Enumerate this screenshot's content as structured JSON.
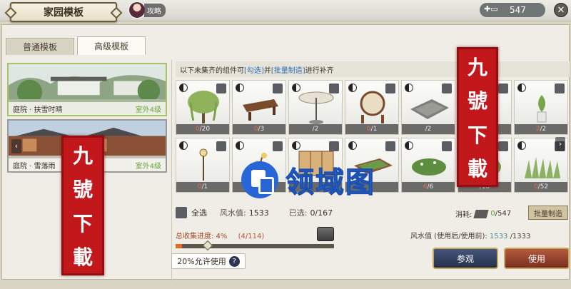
{
  "header": {
    "title": "家园模板",
    "guide_label": "攻略",
    "currency_value": "547",
    "close_glyph": "✕"
  },
  "tabs": [
    {
      "label": "普通模板",
      "active": false
    },
    {
      "label": "高级模板",
      "active": true
    }
  ],
  "scenes": [
    {
      "name": "庭院 · 扶雪时晴",
      "tag": "室外4级",
      "selected": true
    },
    {
      "name": "庭院 · 雪落雨",
      "tag": "室外4级",
      "selected": false
    }
  ],
  "notice": {
    "prefix": "以下未集齐的组件可",
    "opt1": "[勾选]",
    "mid": "并",
    "opt2": "[批量制造]",
    "suffix": "进行补齐"
  },
  "items": [
    {
      "icon": "willow-tree",
      "have": "0",
      "need": "/20"
    },
    {
      "icon": "wooden-table",
      "have": "0",
      "need": "/3"
    },
    {
      "icon": "parasol",
      "have": "",
      "need": "/2"
    },
    {
      "icon": "drum",
      "have": "0",
      "need": "/1"
    },
    {
      "icon": "stone-slab",
      "have": "",
      "need": "/2"
    },
    {
      "icon": "tree",
      "have": "",
      "need": ""
    },
    {
      "icon": "plant-vase",
      "have": "2",
      "need": "/2"
    },
    {
      "icon": "lamp-post",
      "have": "0",
      "need": "/1"
    },
    {
      "icon": "flower-pot",
      "have": "",
      "need": ""
    },
    {
      "icon": "folding-screen",
      "have": "",
      "need": ""
    },
    {
      "icon": "planter-box",
      "have": "",
      "need": ""
    },
    {
      "icon": "shrub",
      "have": "6",
      "need": "/6"
    },
    {
      "icon": "bush",
      "have": "",
      "need": "/18"
    },
    {
      "icon": "grass",
      "have": "0",
      "need": "/52"
    }
  ],
  "footer": {
    "select_all": "全选",
    "fengshui_label": "风水值:",
    "fengshui_value": "1533",
    "selected_label": "已选:",
    "selected_value": "0/167",
    "cost_label": "消耗:",
    "cost_have": "0",
    "cost_total": "/547",
    "batch_button": "批量制造",
    "progress_label": "总收集进度: 4%",
    "progress_count": "(4/114)",
    "progress_fraction": 0.04,
    "fs_compare_label": "风水值 (使用后/使用前):",
    "fs_after": "1533",
    "fs_before": "/1333",
    "allow_label": "20%允许使用",
    "view_button": "参观",
    "use_button": "使用"
  },
  "watermarks": {
    "stamp_text": [
      "九",
      "號",
      "下",
      "載"
    ],
    "site_text": "领域图"
  },
  "colors": {
    "accent_green": "#6da53c",
    "highlight_blue": "#2c6bb8",
    "progress_orange": "#e06a2a",
    "view_button": "#2f3b5c",
    "use_button": "#9c4530",
    "stamp_red": "#c2181c"
  }
}
